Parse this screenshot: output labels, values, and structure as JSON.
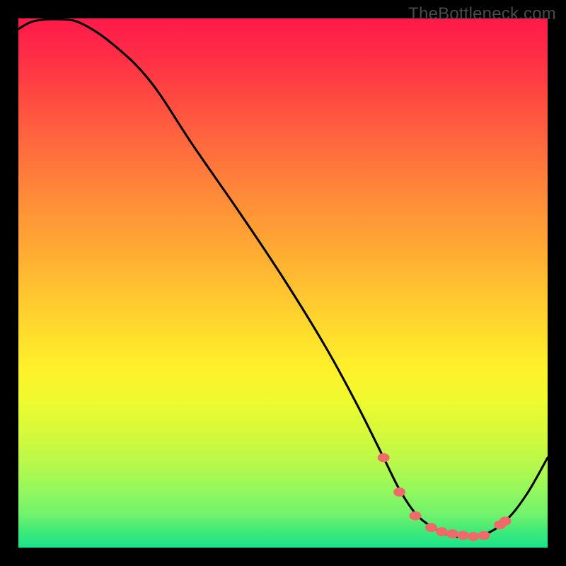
{
  "watermark": "TheBottleneck.com",
  "colors": {
    "background": "#000000",
    "gradient_top": "#ff1a4b",
    "gradient_bottom": "#19e48a",
    "curve_stroke": "#000000",
    "marker_fill": "#f06a6a"
  },
  "chart_data": {
    "type": "line",
    "title": "",
    "xlabel": "",
    "ylabel": "",
    "xlim": [
      0,
      100
    ],
    "ylim": [
      0,
      100
    ],
    "x": [
      0,
      3,
      8,
      12,
      18,
      25,
      33,
      42,
      50,
      58,
      64,
      69,
      72,
      75,
      78,
      81,
      84,
      88,
      92,
      96,
      100
    ],
    "values": [
      98,
      99.5,
      99.8,
      99,
      95,
      88,
      76,
      63,
      51,
      38,
      27,
      17,
      11,
      6.5,
      4,
      2.5,
      2,
      2.5,
      5,
      10,
      17
    ],
    "markers": {
      "x": [
        69,
        72,
        75,
        78,
        80,
        82,
        84,
        86,
        88,
        91,
        92
      ],
      "values": [
        17,
        10.5,
        6.0,
        3.8,
        3.0,
        2.6,
        2.3,
        2.1,
        2.3,
        4.3,
        5.0
      ]
    },
    "notes": "Values read off the plot by eye against the implied 0–100 axes; the curve descends from near-top-left to a minimum around x≈85 then rises toward the right edge. Salmon-colored markers highlight the trough region."
  }
}
